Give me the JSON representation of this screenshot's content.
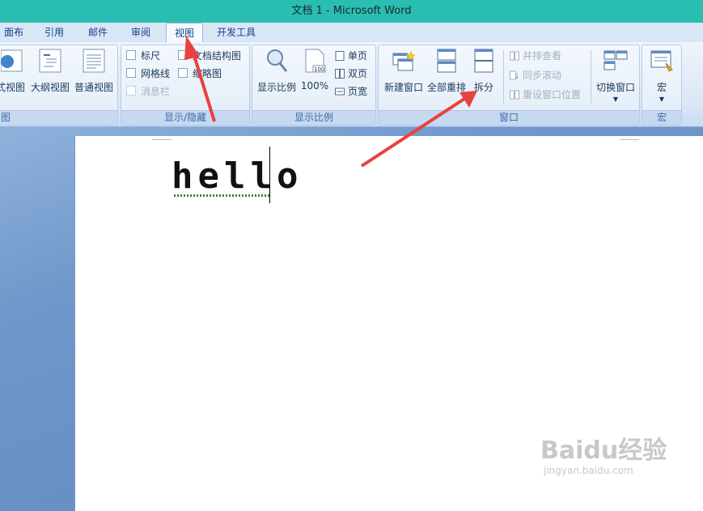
{
  "titlebar": {
    "title": "文档 1 - Microsoft Word"
  },
  "tabs": [
    {
      "label": "面布局"
    },
    {
      "label": "引用"
    },
    {
      "label": "邮件"
    },
    {
      "label": "审阅"
    },
    {
      "label": "视图"
    },
    {
      "label": "开发工具"
    }
  ],
  "ribbon": {
    "views": {
      "label": "图",
      "web_view": "式视图",
      "outline_view": "大纲视图",
      "draft_view": "普通视图"
    },
    "show_hide": {
      "label": "显示/隐藏",
      "ruler": "标尺",
      "gridlines": "网格线",
      "message_bar": "消息栏",
      "doc_map": "文档结构图",
      "thumbnails": "缩略图"
    },
    "zoom": {
      "label": "显示比例",
      "zoom_button": "显示比例",
      "hundred": "100%",
      "one_page": "单页",
      "two_pages": "双页",
      "page_width": "页宽"
    },
    "window": {
      "label": "窗口",
      "new_window": "新建窗口",
      "arrange_all": "全部重排",
      "split": "拆分",
      "side_by_side": "并排查看",
      "sync_scroll": "同步滚动",
      "reset_position": "重设窗口位置",
      "switch_windows": "切换窗口"
    },
    "macros": {
      "label": "宏",
      "macros_button": "宏"
    }
  },
  "document": {
    "text": "hello"
  },
  "watermark": {
    "brand": "Baidu经验",
    "url": "jingyan.baidu.com"
  },
  "colors": {
    "title_bar": "#2abdb1",
    "ribbon": "#dbe8f7",
    "arrow": "#e8413f"
  }
}
